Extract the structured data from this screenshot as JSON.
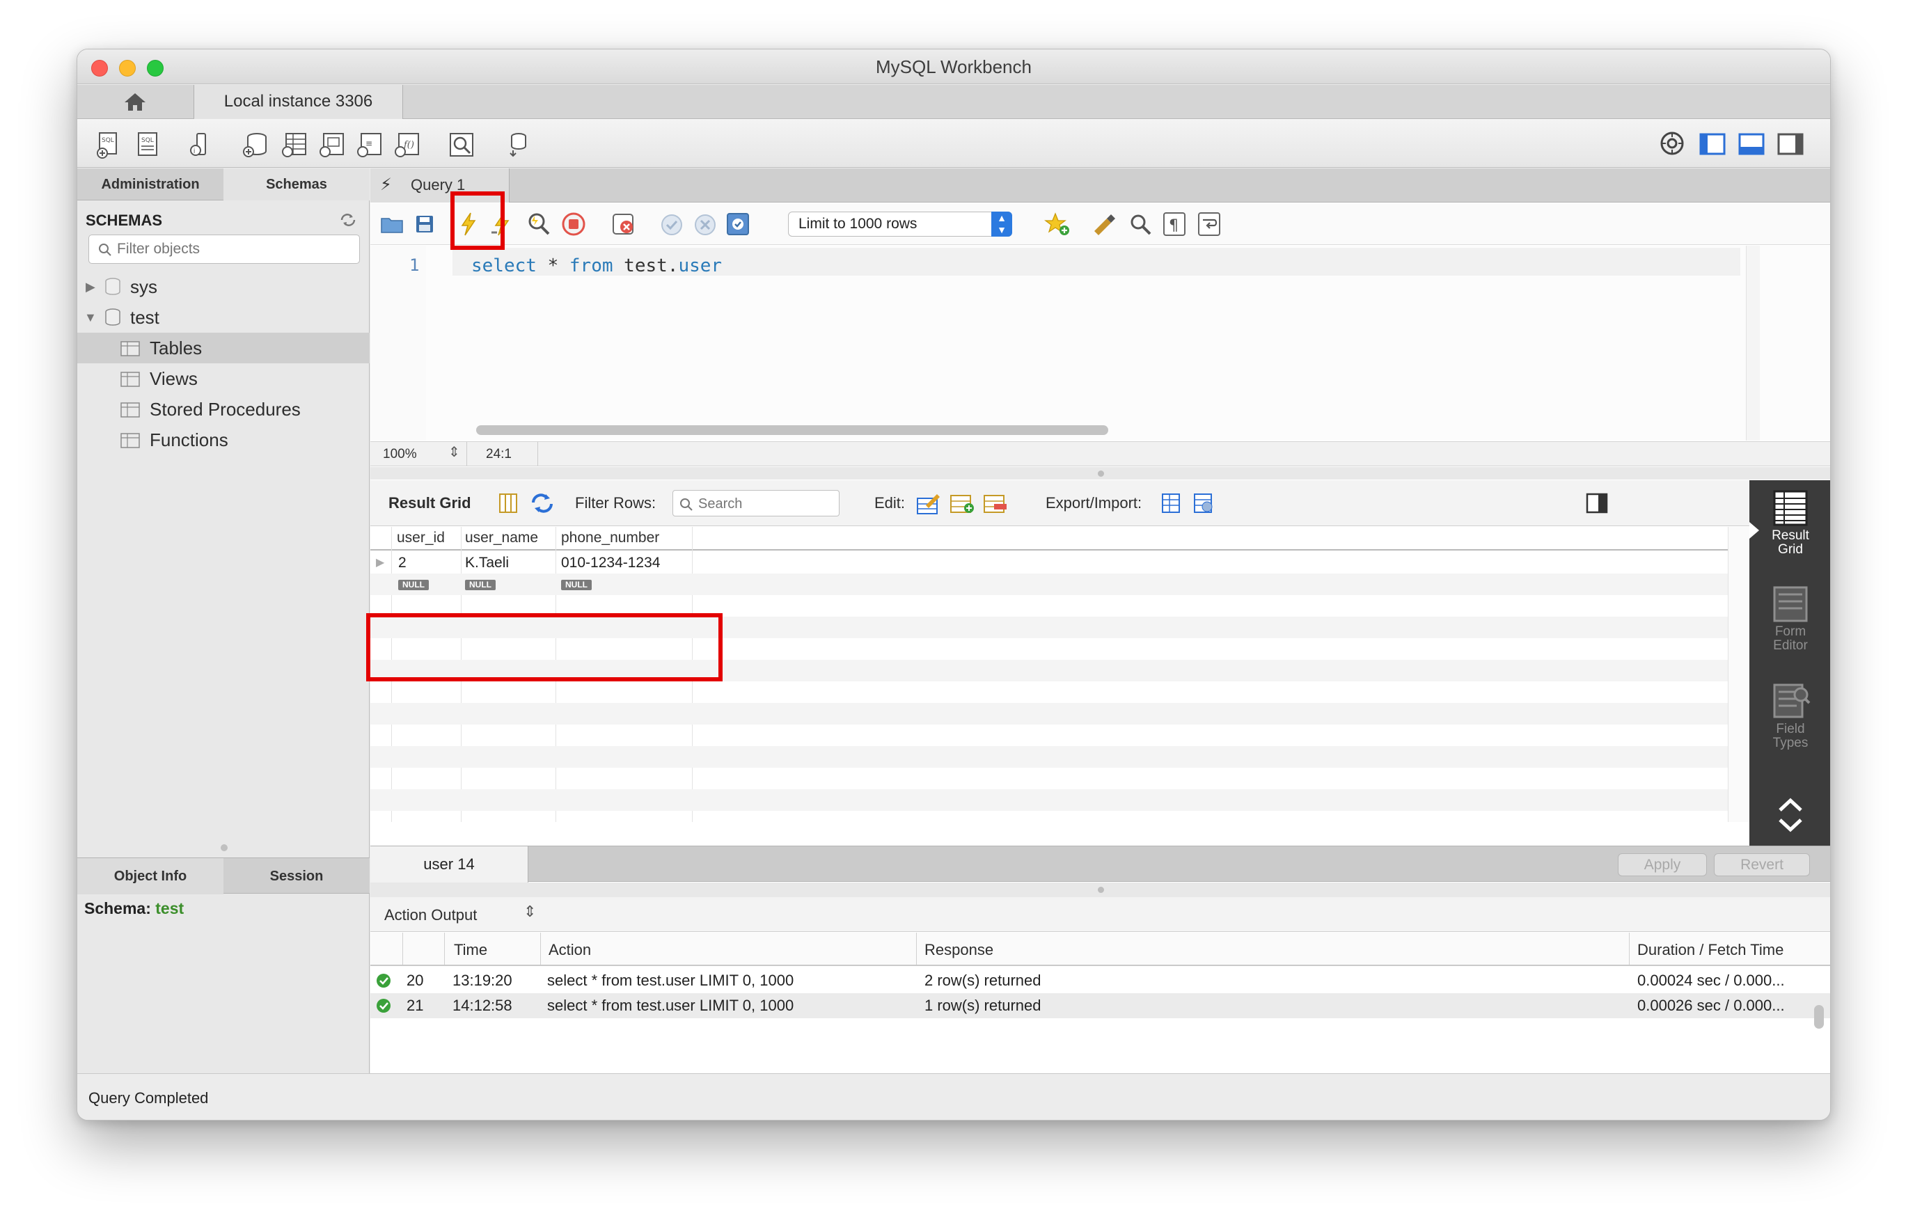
{
  "window": {
    "title": "MySQL Workbench"
  },
  "connection_tab": {
    "label": "Local instance 3306"
  },
  "main_toolbar": {
    "icons": [
      "new-sql-tab-icon",
      "open-sql-script-icon",
      "inspector-icon",
      "create-schema-icon",
      "create-table-icon",
      "create-view-icon",
      "create-procedure-icon",
      "create-function-icon",
      "search-table-data-icon",
      "reconnect-icon"
    ],
    "right_icons": [
      "preferences-icon",
      "toggle-sidebar-icon",
      "toggle-output-icon",
      "toggle-secondary-sidebar-icon"
    ]
  },
  "sidebar": {
    "tabs": [
      "Administration",
      "Schemas"
    ],
    "heading": "SCHEMAS",
    "filter_placeholder": "Filter objects",
    "schemas": [
      {
        "name": "sys",
        "expanded": false
      },
      {
        "name": "test",
        "expanded": true
      }
    ],
    "test_children": [
      "Tables",
      "Views",
      "Stored Procedures",
      "Functions"
    ],
    "bottom_tabs": [
      "Object Info",
      "Session"
    ],
    "schema_label": "Schema:",
    "schema_value": "test"
  },
  "query_tab": {
    "label": "Query 1"
  },
  "query_toolbar": {
    "limit_select": "Limit to 1000 rows"
  },
  "editor": {
    "line_number": "1",
    "code": {
      "kw1": "select",
      "star": " * ",
      "kw2": "from",
      "table": " test.",
      "tname": "user"
    },
    "zoom": "100%",
    "cursor": "24:1"
  },
  "result": {
    "label": "Result Grid",
    "filter_label": "Filter Rows:",
    "search_placeholder": "Search",
    "edit_label": "Edit:",
    "export_label": "Export/Import:",
    "columns": [
      "user_id",
      "user_name",
      "phone_number"
    ],
    "rows": [
      [
        "2",
        "K.Taeli",
        "010-1234-1234"
      ],
      [
        "NULL",
        "NULL",
        "NULL"
      ]
    ],
    "side_panel": [
      {
        "label1": "Result",
        "label2": "Grid",
        "icon": "result-grid-icon"
      },
      {
        "label1": "Form",
        "label2": "Editor",
        "icon": "form-editor-icon"
      },
      {
        "label1": "Field",
        "label2": "Types",
        "icon": "field-types-icon"
      }
    ],
    "result_tab": "user 14",
    "apply": "Apply",
    "revert": "Revert"
  },
  "output": {
    "selector": "Action Output",
    "columns": [
      "Time",
      "Action",
      "Response",
      "Duration / Fetch Time"
    ],
    "rows": [
      {
        "num": "20",
        "time": "13:19:20",
        "action": "select * from test.user LIMIT 0, 1000",
        "response": "2 row(s) returned",
        "duration": "0.00024 sec / 0.000..."
      },
      {
        "num": "21",
        "time": "14:12:58",
        "action": "select * from test.user LIMIT 0, 1000",
        "response": "1 row(s) returned",
        "duration": "0.00026 sec / 0.000..."
      }
    ]
  },
  "status": {
    "text": "Query Completed"
  },
  "colors": {
    "highlight": "#e30000",
    "keyword": "#2a7ab8",
    "success": "#3aa13a",
    "schema_value": "#3b8e2a"
  }
}
